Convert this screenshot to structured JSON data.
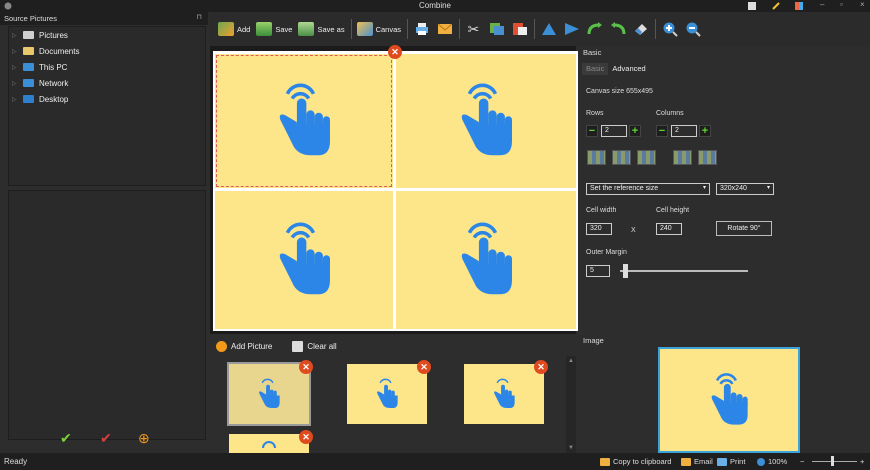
{
  "window": {
    "title": "Combine"
  },
  "left_panel": {
    "header": "Source Pictures",
    "tree": [
      {
        "label": "Pictures",
        "icon": "pictures-folder-icon",
        "color": "#cfcfcf"
      },
      {
        "label": "Documents",
        "icon": "documents-folder-icon",
        "color": "#e8c86a"
      },
      {
        "label": "This PC",
        "icon": "computer-icon",
        "color": "#3a8fd6"
      },
      {
        "label": "Network",
        "icon": "network-icon",
        "color": "#3a8fd6"
      },
      {
        "label": "Desktop",
        "icon": "desktop-icon",
        "color": "#2f7fcf"
      }
    ],
    "actions": [
      {
        "icon": "check-green-icon",
        "glyph": "✔",
        "color": "#7cd13a"
      },
      {
        "icon": "check-red-icon",
        "glyph": "✔",
        "color": "#d64040"
      },
      {
        "icon": "add-orange-icon",
        "glyph": "⊕",
        "color": "#f39a1a"
      }
    ]
  },
  "toolbar": {
    "add_label": "Add",
    "save_label": "Save",
    "save_as_label": "Save as",
    "canvas_label": "Canvas"
  },
  "thumbs_panel": {
    "add_picture_label": "Add Picture",
    "clear_all_label": "Clear all"
  },
  "properties": {
    "header": "Basic",
    "tabs": [
      "Basic",
      "Advanced"
    ],
    "canvas_size": "Canvas size 655x495",
    "rows_label": "Rows",
    "rows_value": "2",
    "columns_label": "Columns",
    "columns_value": "2",
    "reference_select": "Set the reference size",
    "size_select": "320x240",
    "cell_width_label": "Cell width",
    "cell_height_label": "Cell height",
    "cell_width_value": "320",
    "cell_x": "X",
    "cell_height_value": "240",
    "rotate_label": "Rotate 90°",
    "outer_margin_label": "Outer Margin",
    "outer_margin_value": "5",
    "outer_margin_level": 0.03
  },
  "image_panel": {
    "header": "Image"
  },
  "statusbar": {
    "status": "Ready",
    "copy_label": "Copy to clipboard",
    "email_label": "Email",
    "print_label": "Print",
    "zoom_label": "100%",
    "zoom_minus": "−",
    "zoom_plus": "+"
  },
  "colors": {
    "accent": "#3aa3d9",
    "cell_bg": "#fde58a",
    "hand": "#2b86e8",
    "close": "#e04a1f"
  }
}
